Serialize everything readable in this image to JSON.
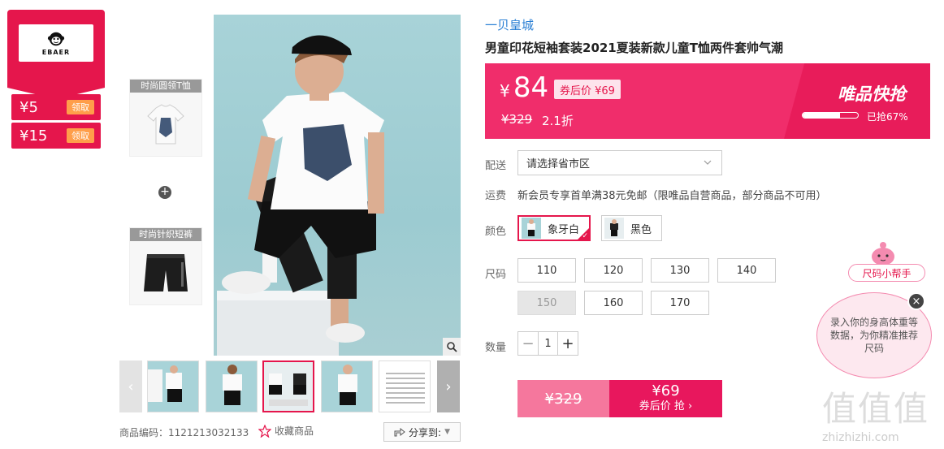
{
  "brand": {
    "name": "EBAER"
  },
  "coupons": [
    {
      "amount": "¥5",
      "claim_label": "领取"
    },
    {
      "amount": "¥15",
      "claim_label": "领取"
    }
  ],
  "combo": {
    "items": [
      {
        "title": "时尚圆领T恤"
      },
      {
        "title": "时尚针织短裤"
      }
    ],
    "plus": "+"
  },
  "gallery": {
    "prev": "‹",
    "next": "›",
    "thumb_count": 6
  },
  "product_meta": {
    "sku_label": "商品编码：1121213032133",
    "favorite_label": "收藏商品",
    "share_label": "分享到:"
  },
  "shop": {
    "name": "一贝皇城"
  },
  "product": {
    "title": "男童印花短袖套装2021夏装新款儿童T恤两件套帅气潮"
  },
  "price": {
    "currency": "¥",
    "current": "84",
    "coupon_price_label": "券后价 ¥69",
    "original": "¥329",
    "discount": "2.1折",
    "flash_title": "唯品快抢",
    "sold_percent": 67,
    "sold_text": "已抢67%"
  },
  "delivery": {
    "label": "配送",
    "select_value": "请选择省市区"
  },
  "shipping": {
    "label": "运费",
    "text": "新会员专享首单满38元免邮（限唯品自营商品，部分商品不可用）"
  },
  "colors": {
    "label": "颜色",
    "options": [
      {
        "name": "象牙白",
        "selected": true
      },
      {
        "name": "黑色",
        "selected": false
      }
    ]
  },
  "sizes": {
    "label": "尺码",
    "options": [
      {
        "value": "110",
        "disabled": false
      },
      {
        "value": "120",
        "disabled": false
      },
      {
        "value": "130",
        "disabled": false
      },
      {
        "value": "140",
        "disabled": false
      },
      {
        "value": "150",
        "disabled": true
      },
      {
        "value": "160",
        "disabled": false
      },
      {
        "value": "170",
        "disabled": false
      }
    ]
  },
  "quantity": {
    "label": "数量",
    "value": "1",
    "minus": "−",
    "plus": "+"
  },
  "buy": {
    "original_price": "¥329",
    "coupon_price": "¥69",
    "coupon_label": "券后价 抢 ›"
  },
  "size_helper": {
    "tag": "尺码小帮手",
    "bubble_text": "录入你的身高体重等数据，为你精准推荐尺码",
    "close": "×"
  },
  "watermark": {
    "logo": "值值值",
    "url": "zhizhizhi.com"
  },
  "colors_theme": {
    "accent": "#e5164c",
    "price_bar": "#f02d6b",
    "link": "#2a7fd4"
  }
}
